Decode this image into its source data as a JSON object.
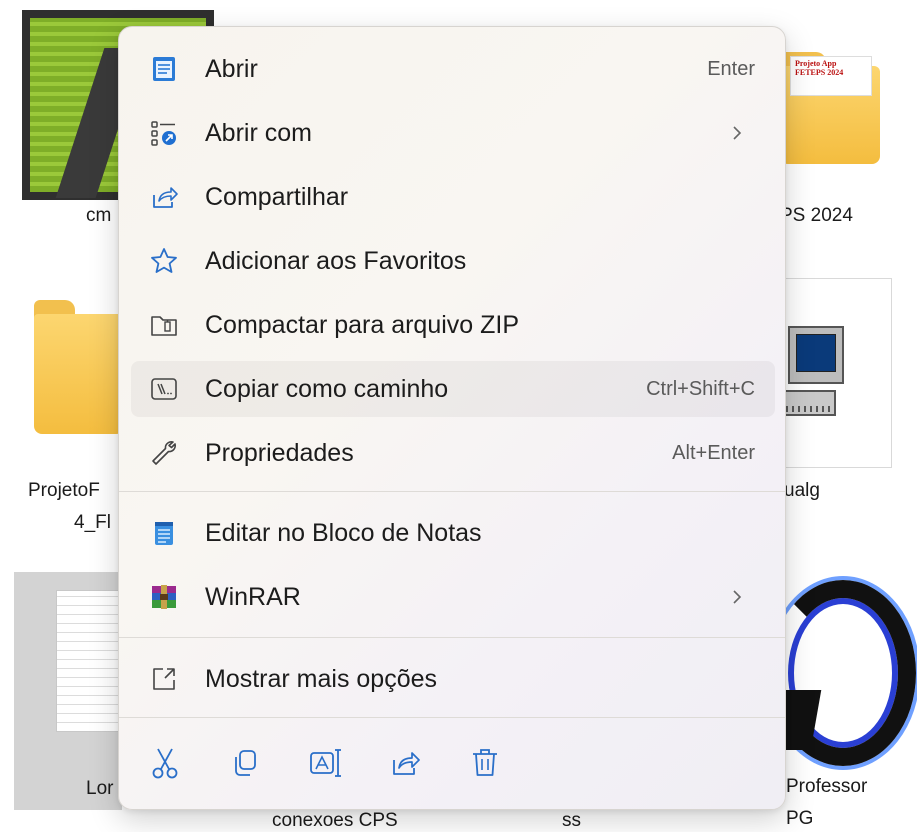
{
  "background": {
    "files": [
      {
        "label": "cm",
        "kind": "cmd"
      },
      {
        "label": "PS 2024",
        "kind": "folder",
        "paper_text": "Projeto App FETEPS 2024"
      },
      {
        "label_line1": "ProjetoF",
        "label_line2": "4_Fl",
        "kind": "folder"
      },
      {
        "label": "ualg",
        "kind": "visualg"
      },
      {
        "label": "Lor",
        "kind": "document"
      },
      {
        "label": "conexoes CPS",
        "kind": "file"
      },
      {
        "label": "ss",
        "kind": "file"
      },
      {
        "label_line1": "Professor",
        "label_line2": "PG",
        "kind": "logo"
      }
    ]
  },
  "menu": {
    "items": [
      {
        "id": "open",
        "label": "Abrir",
        "shortcut": "Enter",
        "icon": "notepad-icon"
      },
      {
        "id": "open-with",
        "label": "Abrir com",
        "icon": "open-with-icon",
        "submenu": true
      },
      {
        "id": "share",
        "label": "Compartilhar",
        "icon": "share-icon"
      },
      {
        "id": "favorites",
        "label": "Adicionar aos Favoritos",
        "icon": "star-icon"
      },
      {
        "id": "zip",
        "label": "Compactar para arquivo ZIP",
        "icon": "zip-folder-icon"
      },
      {
        "id": "copy-path",
        "label": "Copiar como caminho",
        "shortcut": "Ctrl+Shift+C",
        "icon": "copy-path-icon",
        "highlighted": true
      },
      {
        "id": "properties",
        "label": "Propriedades",
        "shortcut": "Alt+Enter",
        "icon": "wrench-icon"
      },
      {
        "id": "notepad",
        "label": "Editar no Bloco de Notas",
        "icon": "notepad-blue-icon"
      },
      {
        "id": "winrar",
        "label": "WinRAR",
        "icon": "winrar-icon",
        "submenu": true
      },
      {
        "id": "more",
        "label": "Mostrar mais opções",
        "icon": "expand-icon"
      }
    ],
    "toolbar": [
      {
        "id": "cut",
        "icon": "scissors-icon"
      },
      {
        "id": "copy",
        "icon": "copy-icon"
      },
      {
        "id": "rename",
        "icon": "rename-icon"
      },
      {
        "id": "share",
        "icon": "share-icon"
      },
      {
        "id": "delete",
        "icon": "trash-icon"
      }
    ]
  },
  "colors": {
    "accent": "#0067c0",
    "menu_bg": "#f7f4ee",
    "hover": "#ebe9e5"
  }
}
